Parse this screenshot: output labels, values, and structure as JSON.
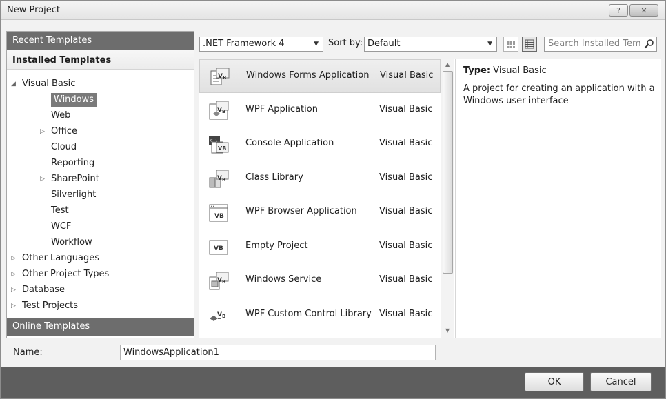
{
  "window": {
    "title": "New Project",
    "help_label": "?",
    "close_label": "✕"
  },
  "left": {
    "recent_label": "Recent Templates",
    "installed_label": "Installed Templates",
    "online_label": "Online Templates",
    "tree": [
      {
        "label": "Visual Basic",
        "level": 0,
        "expander": "◢"
      },
      {
        "label": "Windows",
        "level": 1,
        "selected": true
      },
      {
        "label": "Web",
        "level": 1
      },
      {
        "label": "Office",
        "level": 1,
        "expander": "▷"
      },
      {
        "label": "Cloud",
        "level": 1
      },
      {
        "label": "Reporting",
        "level": 1
      },
      {
        "label": "SharePoint",
        "level": 1,
        "expander": "▷"
      },
      {
        "label": "Silverlight",
        "level": 1
      },
      {
        "label": "Test",
        "level": 1
      },
      {
        "label": "WCF",
        "level": 1
      },
      {
        "label": "Workflow",
        "level": 1
      },
      {
        "label": "Other Languages",
        "level": 0,
        "expander": "▷"
      },
      {
        "label": "Other Project Types",
        "level": 0,
        "expander": "▷"
      },
      {
        "label": "Database",
        "level": 0,
        "expander": "▷"
      },
      {
        "label": "Test Projects",
        "level": 0,
        "expander": "▷"
      }
    ]
  },
  "toolbar": {
    "framework_value": ".NET Framework 4",
    "sortby_label": "Sort by:",
    "sort_value": "Default",
    "search_placeholder": "Search Installed Tem"
  },
  "templates": [
    {
      "name": "Windows Forms Application",
      "language": "Visual Basic",
      "icon": "windows-forms-icon",
      "selected": true
    },
    {
      "name": "WPF Application",
      "language": "Visual Basic",
      "icon": "wpf-application-icon"
    },
    {
      "name": "Console Application",
      "language": "Visual Basic",
      "icon": "console-application-icon"
    },
    {
      "name": "Class Library",
      "language": "Visual Basic",
      "icon": "class-library-icon"
    },
    {
      "name": "WPF Browser Application",
      "language": "Visual Basic",
      "icon": "wpf-browser-icon"
    },
    {
      "name": "Empty Project",
      "language": "Visual Basic",
      "icon": "empty-project-icon"
    },
    {
      "name": "Windows Service",
      "language": "Visual Basic",
      "icon": "windows-service-icon"
    },
    {
      "name": "WPF Custom Control Library",
      "language": "Visual Basic",
      "icon": "wpf-custom-control-icon"
    }
  ],
  "details": {
    "type_label": "Type:",
    "type_value": "Visual Basic",
    "description": "A project for creating an application with a Windows user interface"
  },
  "name_field": {
    "label_prefix": "N",
    "label_rest": "ame:",
    "value": "WindowsApplication1"
  },
  "buttons": {
    "ok": "OK",
    "cancel": "Cancel"
  }
}
